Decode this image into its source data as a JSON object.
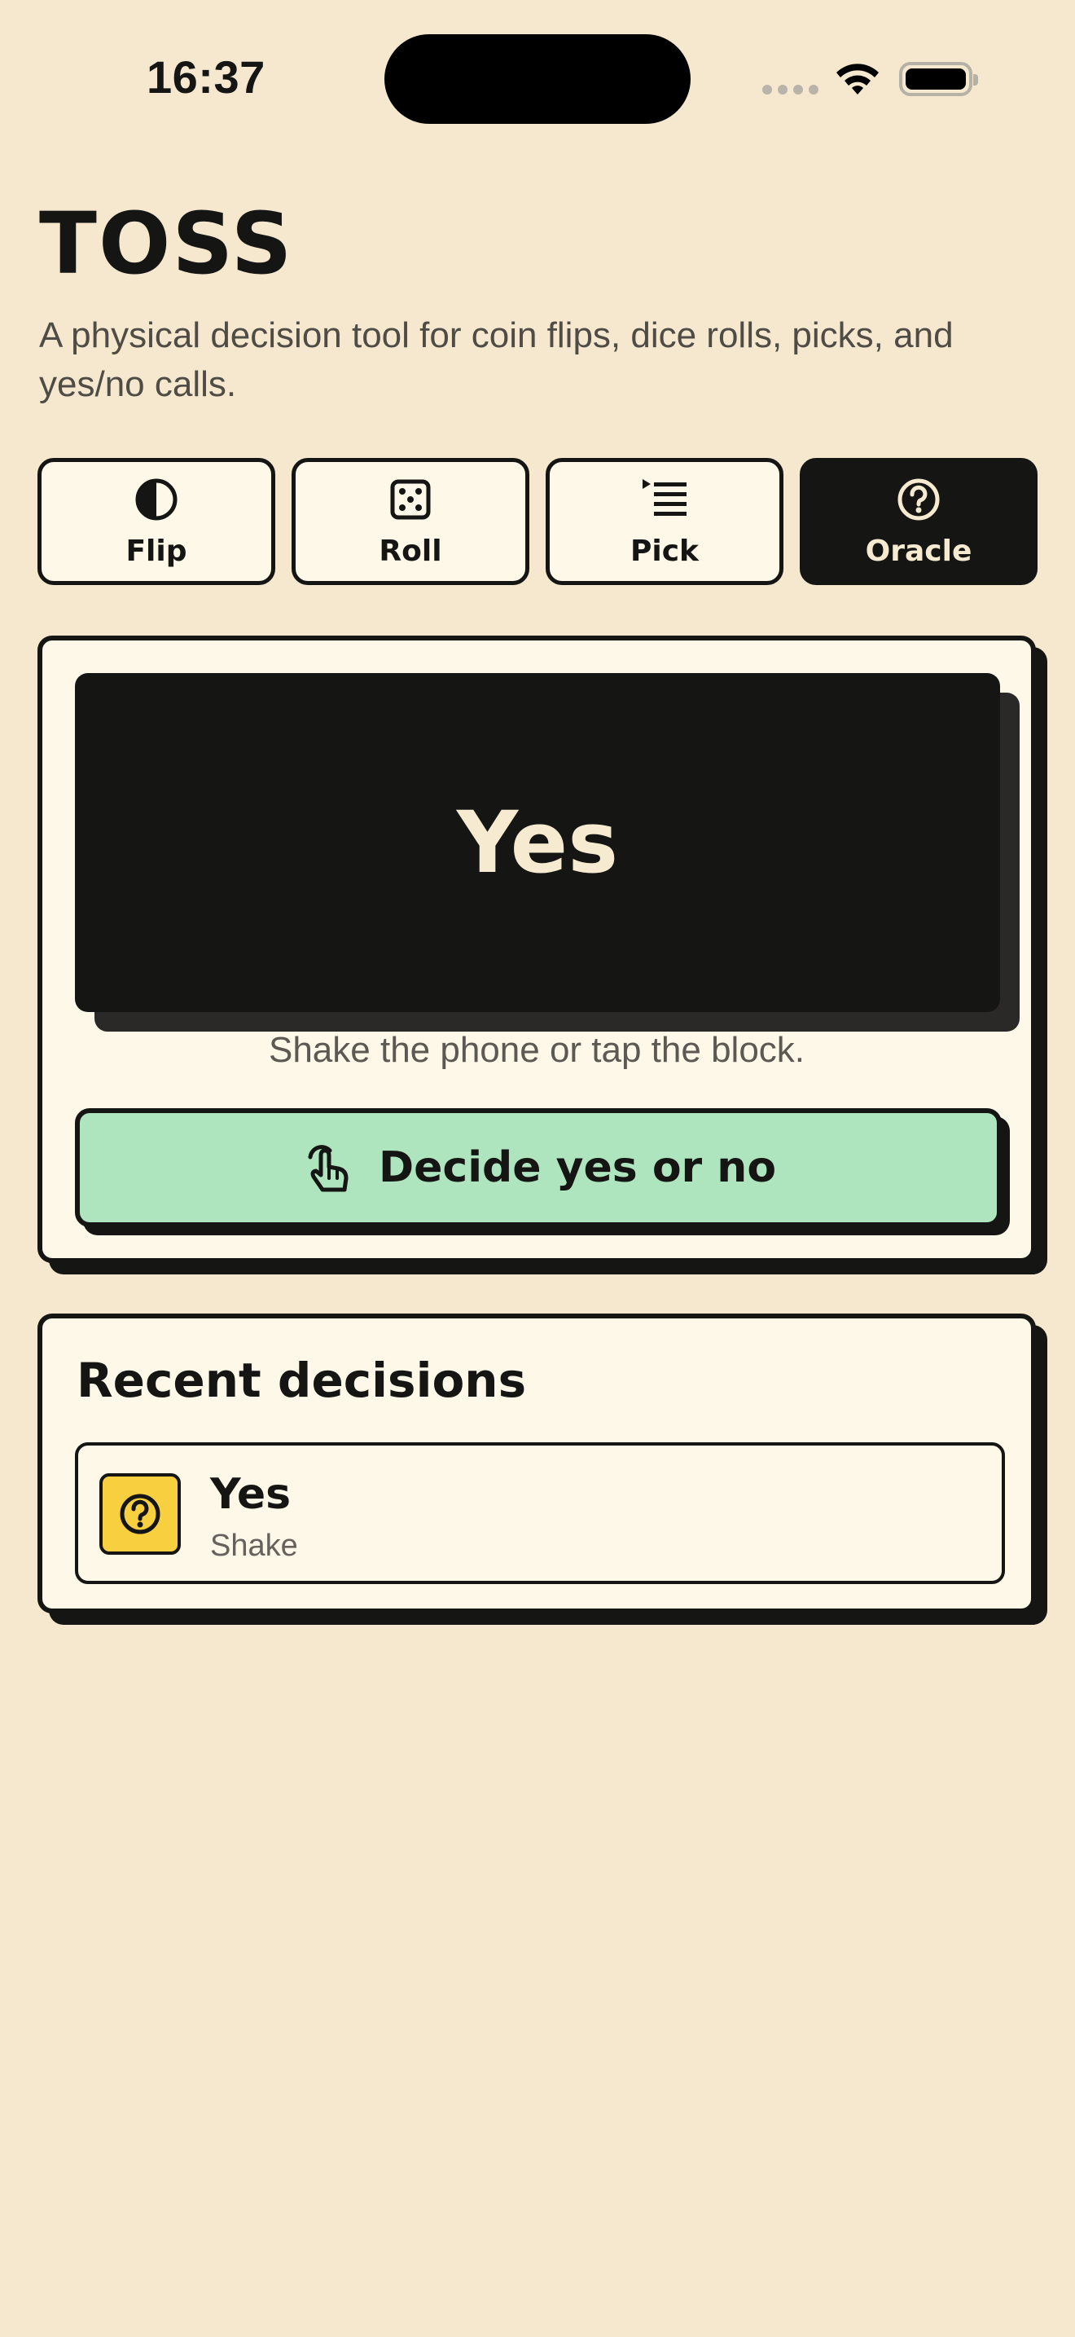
{
  "status_bar": {
    "time": "16:37"
  },
  "header": {
    "title": "TOSS",
    "subtitle": "A physical decision tool for coin flips, dice rolls, picks, and yes/no calls."
  },
  "tabs": [
    {
      "label": "Flip",
      "icon": "half-circle-icon",
      "active": false
    },
    {
      "label": "Roll",
      "icon": "dice-icon",
      "active": false
    },
    {
      "label": "Pick",
      "icon": "list-icon",
      "active": false
    },
    {
      "label": "Oracle",
      "icon": "question-circle-icon",
      "active": true
    }
  ],
  "oracle": {
    "answer": "Yes",
    "hint": "Shake the phone or tap the block.",
    "button_label": "Decide yes or no",
    "button_icon": "tap-hand-icon"
  },
  "recent": {
    "title": "Recent decisions",
    "items": [
      {
        "result": "Yes",
        "method": "Shake",
        "icon": "question-circle-icon"
      }
    ]
  },
  "colors": {
    "background": "#f5e8cf",
    "card": "#fdf8e8",
    "ink": "#151513",
    "accent_green": "#aee5bf",
    "accent_yellow": "#f8d03f"
  }
}
